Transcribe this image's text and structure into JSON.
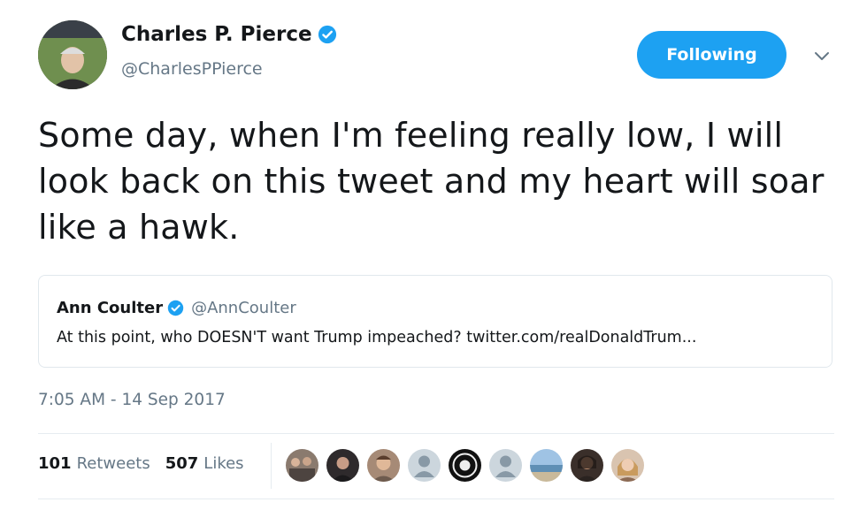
{
  "author": {
    "name": "Charles P. Pierce",
    "handle": "@CharlesPPierce",
    "verified": true,
    "avatar_icon": "profile-photo"
  },
  "follow_button": {
    "label": "Following"
  },
  "menu_icon": "chevron-down-icon",
  "tweet": {
    "text": "Some day, when I'm feeling really low, I will look back on this tweet and my heart will soar like a hawk."
  },
  "quoted_tweet": {
    "name": "Ann Coulter",
    "handle": "@AnnCoulter",
    "verified": true,
    "text": "At this point, who DOESN'T want Trump impeached? twitter.com/realDonaldTrum..."
  },
  "timestamp": "7:05 AM - 14 Sep 2017",
  "stats": {
    "retweets_count": "101",
    "retweets_label": "Retweets",
    "likes_count": "507",
    "likes_label": "Likes"
  },
  "likers": [
    {
      "icon": "liker-avatar-group-photo"
    },
    {
      "icon": "liker-avatar-dark-portrait"
    },
    {
      "icon": "liker-avatar-selfie"
    },
    {
      "icon": "liker-avatar-default-egg"
    },
    {
      "icon": "liker-avatar-logo-badge"
    },
    {
      "icon": "liker-avatar-default-egg"
    },
    {
      "icon": "liker-avatar-landscape"
    },
    {
      "icon": "liker-avatar-dark-portrait"
    },
    {
      "icon": "liker-avatar-blonde-portrait"
    }
  ],
  "colors": {
    "brand_blue": "#1da1f2",
    "text_primary": "#14171a",
    "text_secondary": "#657786",
    "border": "#e1e8ed"
  }
}
